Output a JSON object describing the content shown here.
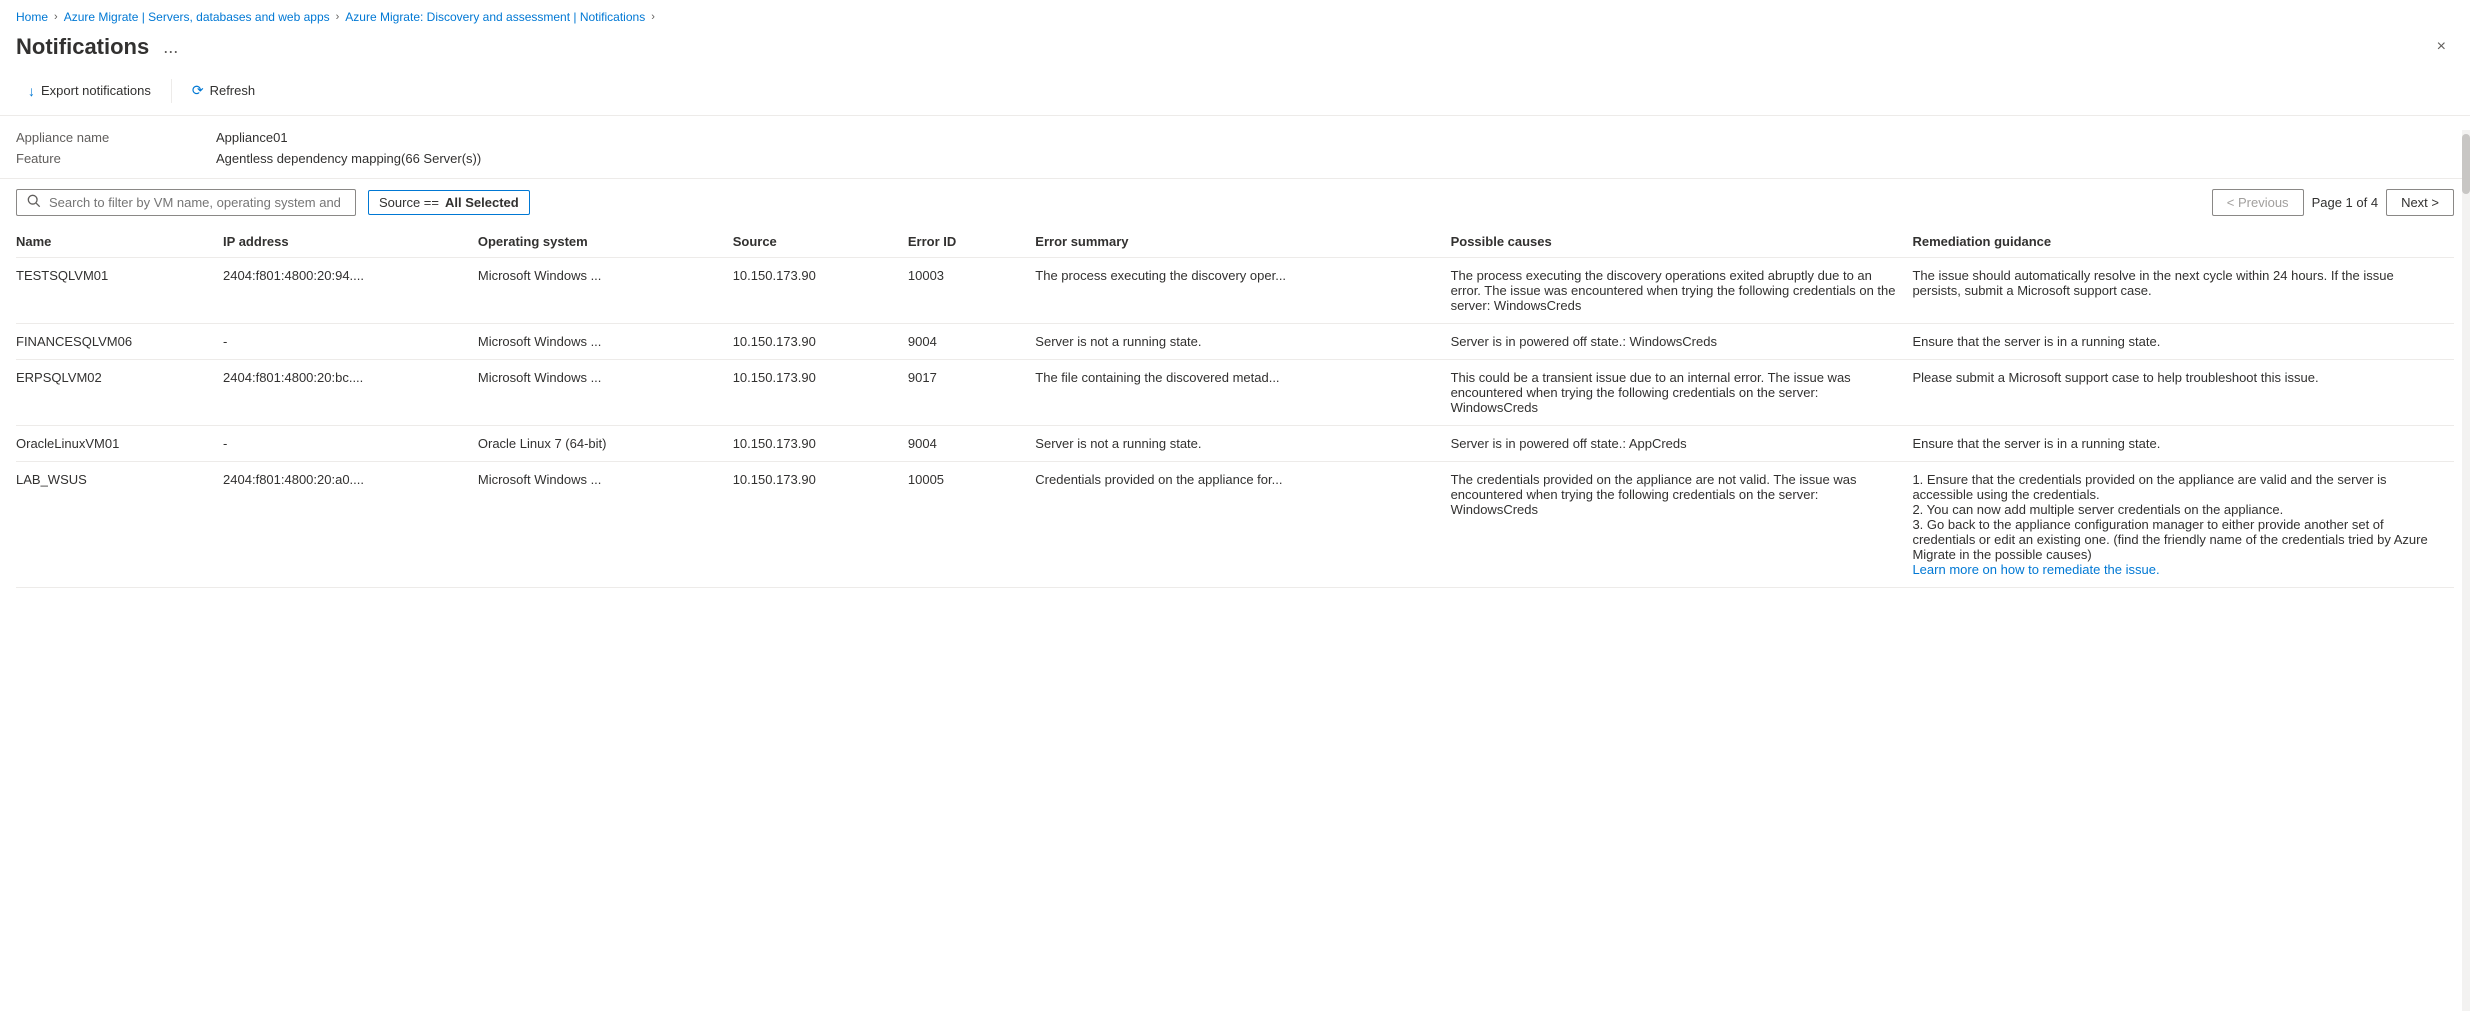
{
  "breadcrumb": {
    "items": [
      {
        "label": "Home",
        "href": "#"
      },
      {
        "label": "Azure Migrate | Servers, databases and web apps",
        "href": "#"
      },
      {
        "label": "Azure Migrate: Discovery and assessment | Notifications",
        "href": "#"
      }
    ]
  },
  "header": {
    "title": "Notifications",
    "ellipsis": "...",
    "close_label": "×"
  },
  "toolbar": {
    "export_label": "Export notifications",
    "refresh_label": "Refresh"
  },
  "info": {
    "appliance_label": "Appliance name",
    "appliance_value": "Appliance01",
    "feature_label": "Feature",
    "feature_value": "Agentless dependency mapping(66 Server(s))"
  },
  "filter": {
    "search_placeholder": "Search to filter by VM name, operating system and error ID",
    "tag_prefix": "Source == ",
    "tag_value": "All Selected",
    "page_info": "Page 1 of 4",
    "prev_label": "< Previous",
    "next_label": "Next >"
  },
  "table": {
    "columns": [
      "Name",
      "IP address",
      "Operating system",
      "Source",
      "Error ID",
      "Error summary",
      "Possible causes",
      "Remediation guidance"
    ],
    "rows": [
      {
        "name": "TESTSQLVM01",
        "ip": "2404:f801:4800:20:94....",
        "os": "Microsoft Windows ...",
        "source": "10.150.173.90",
        "error_id": "10003",
        "error_summary": "The process executing the discovery oper...",
        "possible_causes": "The process executing the discovery operations exited abruptly due to an error. The issue was encountered when trying the following credentials on the server: WindowsCreds",
        "remediation": "The issue should automatically resolve in the next cycle within 24 hours. If the issue persists, submit a Microsoft support case.",
        "learn_more": null
      },
      {
        "name": "FINANCESQLVM06",
        "ip": "-",
        "os": "Microsoft Windows ...",
        "source": "10.150.173.90",
        "error_id": "9004",
        "error_summary": "Server is not a running state.",
        "possible_causes": "Server is in powered off state.: WindowsCreds",
        "remediation": "Ensure that the server is in a running state.",
        "learn_more": null
      },
      {
        "name": "ERPSQLVM02",
        "ip": "2404:f801:4800:20:bc....",
        "os": "Microsoft Windows ...",
        "source": "10.150.173.90",
        "error_id": "9017",
        "error_summary": "The file containing the discovered metad...",
        "possible_causes": "This could be a transient issue due to an internal error. The issue was encountered when trying the following credentials on the server: WindowsCreds",
        "remediation": "Please submit a Microsoft support case to help troubleshoot this issue.",
        "learn_more": null
      },
      {
        "name": "OracleLinuxVM01",
        "ip": "-",
        "os": "Oracle Linux 7 (64-bit)",
        "source": "10.150.173.90",
        "error_id": "9004",
        "error_summary": "Server is not a running state.",
        "possible_causes": "Server is in powered off state.: AppCreds",
        "remediation": "Ensure that the server is in a running state.",
        "learn_more": null
      },
      {
        "name": "LAB_WSUS",
        "ip": "2404:f801:4800:20:a0....",
        "os": "Microsoft Windows ...",
        "source": "10.150.173.90",
        "error_id": "10005",
        "error_summary": "Credentials provided on the appliance for...",
        "possible_causes": "The credentials provided on the appliance are not valid. The issue was encountered when trying the following credentials on the server: WindowsCreds",
        "remediation": "1. Ensure that the credentials provided on the appliance are valid and the server is accessible using the credentials.\n2. You can now add multiple server credentials on the appliance.\n3. Go back to the appliance configuration manager to either provide another set of credentials or edit an existing one. (find the friendly name of the credentials tried by Azure Migrate in the possible causes)",
        "learn_more": "Learn more"
      }
    ]
  }
}
